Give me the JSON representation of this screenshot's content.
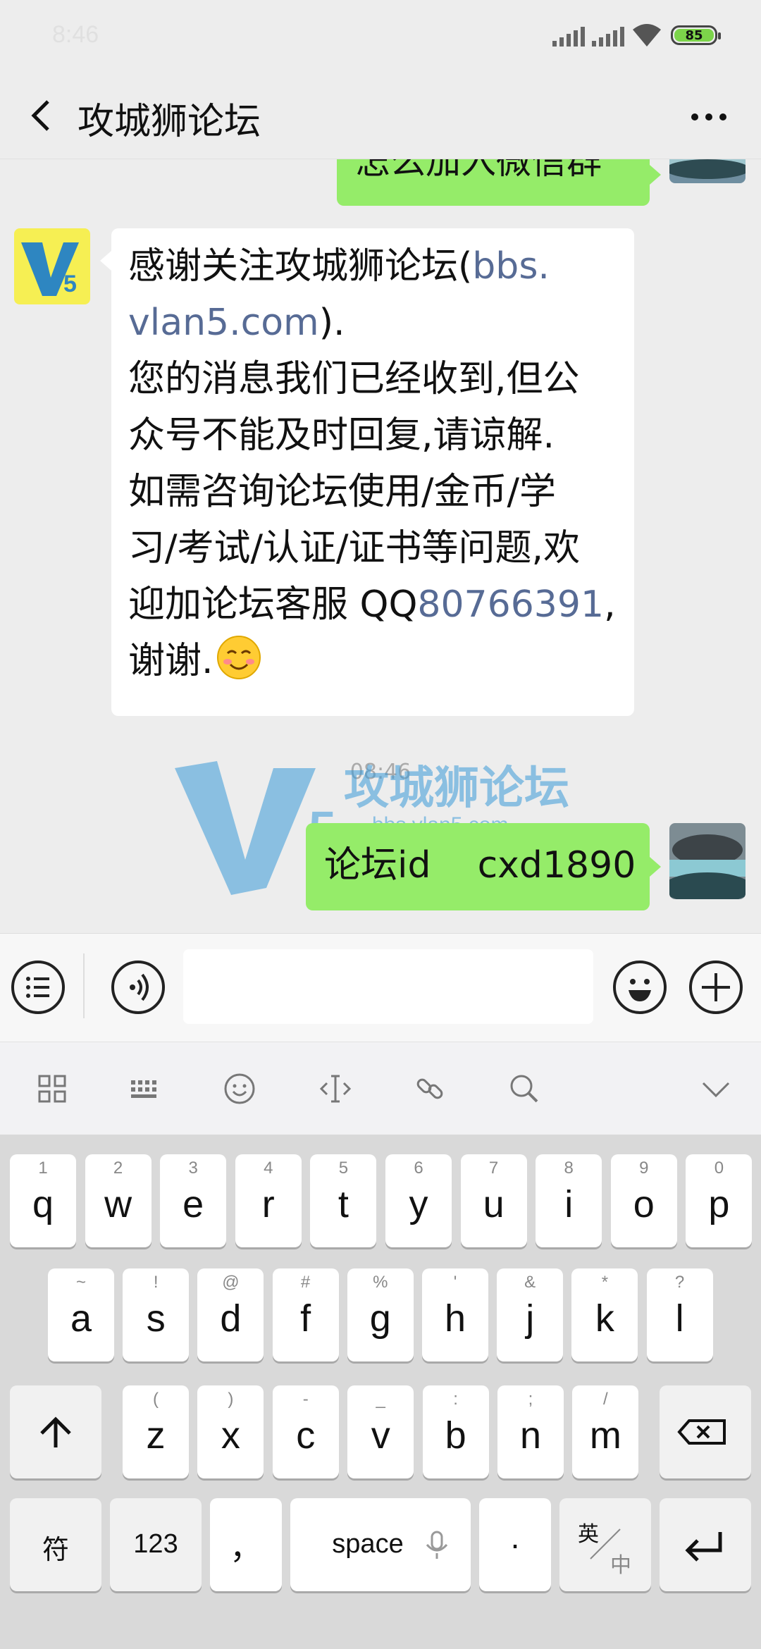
{
  "status_bar": {
    "time": "8:46",
    "battery_level": "85"
  },
  "header": {
    "title": "攻城狮论坛"
  },
  "messages": {
    "partial_sent": "怎么加入微信群",
    "reply_1": "感谢关注攻城狮论坛(",
    "reply_link_a": "bbs.",
    "reply_link_b": "vlan5.com",
    "reply_2": ").",
    "reply_3": "您的消息我们已经收到,但公",
    "reply_4": "众号不能及时回复,请谅解.",
    "reply_5": "如需咨询论坛使用/金币/学",
    "reply_6": "习/考试/认证/证书等问题,欢",
    "reply_7": "迎加论坛客服 QQ",
    "reply_qq": "80766391",
    "reply_8": ",",
    "reply_9": "谢谢.",
    "timestamp": "08:46",
    "last_sent": "论坛id    cxd1890",
    "watermark_text": "攻城狮论坛",
    "watermark_url": "bbs.vlan5.com"
  },
  "keyboard": {
    "row1": [
      {
        "k": "q",
        "s": "1"
      },
      {
        "k": "w",
        "s": "2"
      },
      {
        "k": "e",
        "s": "3"
      },
      {
        "k": "r",
        "s": "4"
      },
      {
        "k": "t",
        "s": "5"
      },
      {
        "k": "y",
        "s": "6"
      },
      {
        "k": "u",
        "s": "7"
      },
      {
        "k": "i",
        "s": "8"
      },
      {
        "k": "o",
        "s": "9"
      },
      {
        "k": "p",
        "s": "0"
      }
    ],
    "row2": [
      {
        "k": "a",
        "s": "~"
      },
      {
        "k": "s",
        "s": "!"
      },
      {
        "k": "d",
        "s": "@"
      },
      {
        "k": "f",
        "s": "#"
      },
      {
        "k": "g",
        "s": "%"
      },
      {
        "k": "h",
        "s": "'"
      },
      {
        "k": "j",
        "s": "&"
      },
      {
        "k": "k",
        "s": "*"
      },
      {
        "k": "l",
        "s": "?"
      }
    ],
    "row3": [
      {
        "k": "z",
        "s": "("
      },
      {
        "k": "x",
        "s": ")"
      },
      {
        "k": "c",
        "s": "-"
      },
      {
        "k": "v",
        "s": "_"
      },
      {
        "k": "b",
        "s": ":"
      },
      {
        "k": "n",
        "s": ";"
      },
      {
        "k": "m",
        "s": "/"
      }
    ],
    "symbol_key": "符",
    "numbers_key": "123",
    "comma_key": "，",
    "space_key": "space",
    "period_key": "·",
    "lang_top": "英",
    "lang_bottom": "中"
  }
}
